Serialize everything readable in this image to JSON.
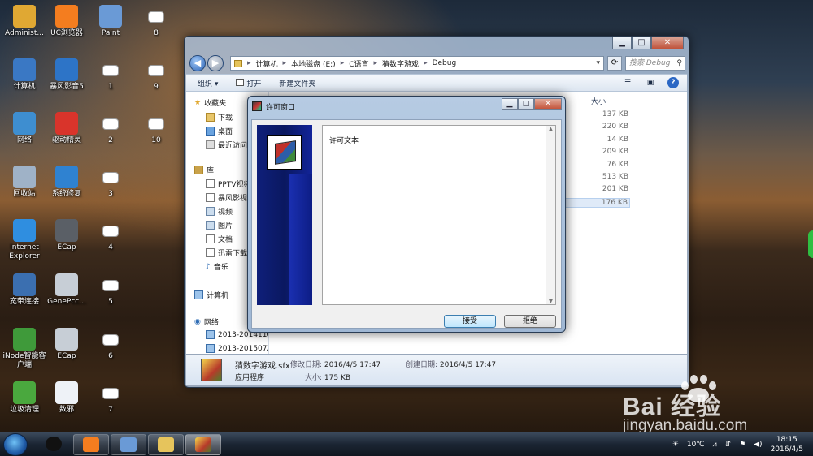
{
  "desktop": {
    "icons": [
      {
        "label": "Administ...",
        "col": 0,
        "row": 0,
        "color": "#e0a833"
      },
      {
        "label": "UC浏览器",
        "col": 1,
        "row": 0,
        "color": "#f47d1f"
      },
      {
        "label": "Paint",
        "col": 2,
        "row": 0,
        "color": "#6a9ad6"
      },
      {
        "label": "8",
        "col": 3,
        "row": 0,
        "small": true
      },
      {
        "label": "计算机",
        "col": 0,
        "row": 1,
        "color": "#3a78c4"
      },
      {
        "label": "暴风影音5",
        "col": 1,
        "row": 1,
        "color": "#2d74c7"
      },
      {
        "label": "1",
        "col": 2,
        "row": 1,
        "small": true
      },
      {
        "label": "9",
        "col": 3,
        "row": 1,
        "small": true
      },
      {
        "label": "网络",
        "col": 0,
        "row": 2,
        "color": "#3e8ed0"
      },
      {
        "label": "驱动精灵",
        "col": 1,
        "row": 2,
        "color": "#d9342b"
      },
      {
        "label": "2",
        "col": 2,
        "row": 2,
        "small": true
      },
      {
        "label": "10",
        "col": 3,
        "row": 2,
        "small": true
      },
      {
        "label": "回收站",
        "col": 0,
        "row": 3,
        "color": "#9fb2c7"
      },
      {
        "label": "系统修复",
        "col": 1,
        "row": 3,
        "color": "#2f82d1"
      },
      {
        "label": "3",
        "col": 2,
        "row": 3,
        "small": true
      },
      {
        "label": "Internet Explorer",
        "col": 0,
        "row": 4,
        "color": "#2f8ee0"
      },
      {
        "label": "ECap",
        "col": 1,
        "row": 4,
        "color": "#5a5f66"
      },
      {
        "label": "4",
        "col": 2,
        "row": 4,
        "small": true
      },
      {
        "label": "宽带连接",
        "col": 0,
        "row": 5,
        "color": "#3b6fb0"
      },
      {
        "label": "GenePcc...",
        "col": 1,
        "row": 5,
        "color": "#c7ced6"
      },
      {
        "label": "5",
        "col": 2,
        "row": 5,
        "small": true
      },
      {
        "label": "iNode智能客户端",
        "col": 0,
        "row": 6,
        "color": "#3f9a3a"
      },
      {
        "label": "ECap",
        "col": 1,
        "row": 6,
        "color": "#c7ced6"
      },
      {
        "label": "6",
        "col": 2,
        "row": 6,
        "small": true
      },
      {
        "label": "垃圾清理",
        "col": 0,
        "row": 7,
        "color": "#4aa83e"
      },
      {
        "label": "数邪",
        "col": 1,
        "row": 7,
        "color": "#eef2f7"
      },
      {
        "label": "7",
        "col": 2,
        "row": 7,
        "small": true
      }
    ]
  },
  "explorer": {
    "controls": {
      "minimize": "▁",
      "maximize": "□",
      "close": "✕"
    },
    "address": {
      "path": [
        "计算机",
        "本地磁盘 (E:)",
        "C语言",
        "猜数字游戏",
        "Debug"
      ]
    },
    "search_placeholder": "搜索 Debug",
    "toolbar": {
      "organize": "组织 ▾",
      "open": "打开",
      "new_folder": "新建文件夹"
    },
    "nav": {
      "favorites": "收藏夹",
      "favorites_items": [
        "下载",
        "桌面",
        "最近访问"
      ],
      "libraries": "库",
      "library_items": [
        "PPTV视频",
        "暴风影视",
        "视频",
        "图片",
        "文档",
        "迅雷下载",
        "音乐"
      ],
      "computer": "计算机",
      "network": "网络",
      "network_items": [
        "2013-20141108",
        "2013-20150721"
      ]
    },
    "size_header": "大小",
    "sizes": [
      "137 KB",
      "220 KB",
      "14 KB",
      "209 KB",
      "76 KB",
      "513 KB",
      "201 KB",
      "176 KB"
    ],
    "selected_size_index": 7,
    "details": {
      "filename": "猜数字游戏.sfx",
      "modified_label": "修改日期:",
      "modified": "2016/4/5 17:47",
      "created_label": "创建日期:",
      "created": "2016/4/5 17:47",
      "type": "应用程序",
      "size_label": "大小:",
      "size": "175 KB"
    }
  },
  "dialog": {
    "title": "许可窗口",
    "license_text": "许可文本",
    "accept": "接受",
    "decline": "拒绝",
    "controls": {
      "minimize": "▁",
      "maximize": "□",
      "close": "✕"
    }
  },
  "taskbar": {
    "temperature": "10℃",
    "time": "18:15",
    "date": "2016/4/5"
  },
  "watermark": {
    "brand": "Bai  经验",
    "url": "jingyan.baidu.com"
  }
}
